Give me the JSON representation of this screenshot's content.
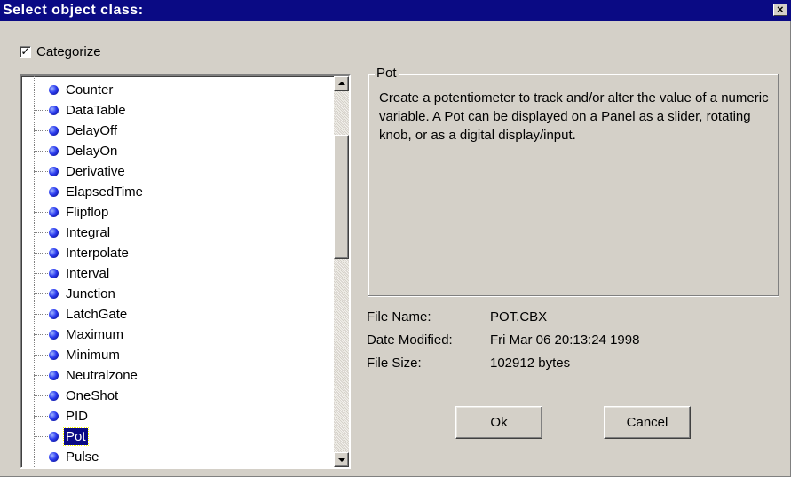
{
  "window": {
    "title": "Select object class:",
    "close_label": "×"
  },
  "categorize": {
    "label": "Categorize",
    "checked": true,
    "check_mark": "✓"
  },
  "list": {
    "items": [
      {
        "label": "Counter"
      },
      {
        "label": "DataTable"
      },
      {
        "label": "DelayOff"
      },
      {
        "label": "DelayOn"
      },
      {
        "label": "Derivative"
      },
      {
        "label": "ElapsedTime"
      },
      {
        "label": "Flipflop"
      },
      {
        "label": "Integral"
      },
      {
        "label": "Interpolate"
      },
      {
        "label": "Interval"
      },
      {
        "label": "Junction"
      },
      {
        "label": "LatchGate"
      },
      {
        "label": "Maximum"
      },
      {
        "label": "Minimum"
      },
      {
        "label": "Neutralzone"
      },
      {
        "label": "OneShot"
      },
      {
        "label": "PID"
      },
      {
        "label": "Pot",
        "selected": true
      },
      {
        "label": "Pulse"
      }
    ]
  },
  "group": {
    "title": "Pot",
    "description": "Create a potentiometer to track and/or alter the value of a numeric variable. A Pot can be displayed on a Panel as a slider, rotating knob, or as a digital display/input."
  },
  "file_info": {
    "name_label": "File Name:",
    "name_value": "POT.CBX",
    "date_label": "Date Modified:",
    "date_value": "Fri Mar 06 20:13:24 1998",
    "size_label": "File Size:",
    "size_value": "102912 bytes"
  },
  "buttons": {
    "ok": "Ok",
    "cancel": "Cancel"
  },
  "colors": {
    "titlebar": "#0a0a84",
    "face": "#d4d0c8",
    "selection": "#0a0a84",
    "bullet": "#2b3cf0"
  }
}
